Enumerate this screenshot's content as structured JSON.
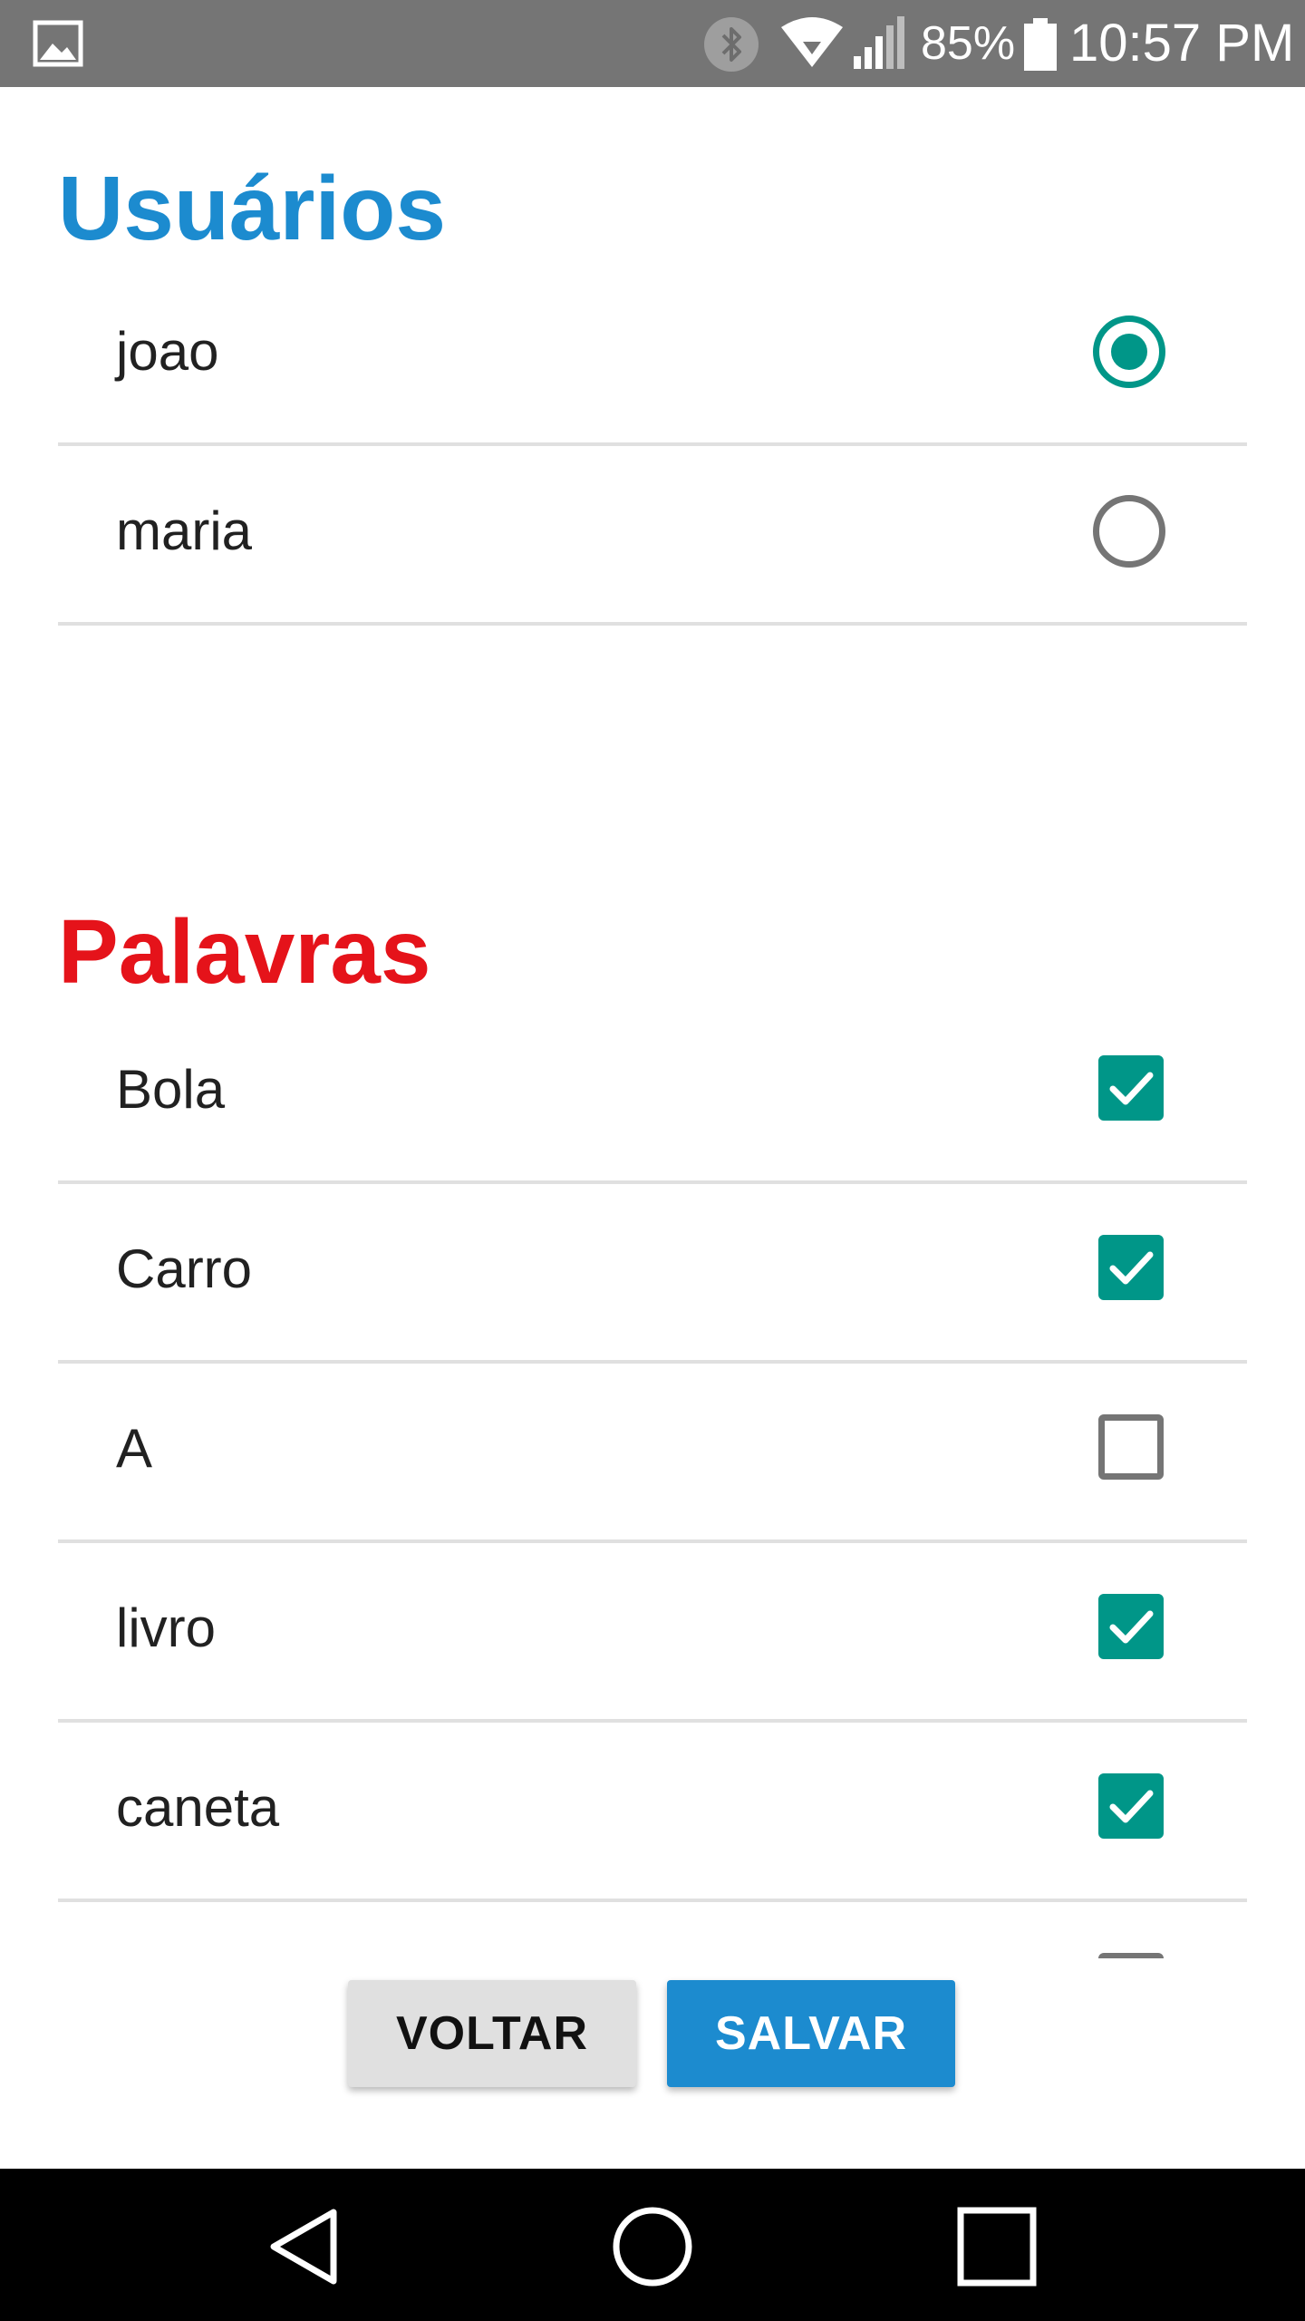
{
  "status_bar": {
    "battery_percent": "85%",
    "time": "10:57 PM",
    "icons": [
      "gallery-icon",
      "bluetooth-icon",
      "wifi-icon",
      "signal-icon",
      "battery-icon"
    ]
  },
  "users": {
    "title": "Usuários",
    "items": [
      {
        "label": "joao",
        "selected": true
      },
      {
        "label": "maria",
        "selected": false
      }
    ]
  },
  "words": {
    "title": "Palavras",
    "items": [
      {
        "label": "Bola",
        "checked": true
      },
      {
        "label": "Carro",
        "checked": true
      },
      {
        "label": "A",
        "checked": false
      },
      {
        "label": "livro",
        "checked": true
      },
      {
        "label": "caneta",
        "checked": true
      },
      {
        "label": "",
        "checked": false
      }
    ]
  },
  "buttons": {
    "back_label": "VOLTAR",
    "save_label": "SALVAR"
  },
  "colors": {
    "users_title": "#1c8bcf",
    "words_title": "#e5131a",
    "accent": "#009688",
    "primary_button": "#1c8bcf",
    "secondary_button": "#e0e0e0"
  },
  "nav_bar": {
    "icons": [
      "back-triangle-icon",
      "home-circle-icon",
      "recents-square-icon"
    ]
  }
}
